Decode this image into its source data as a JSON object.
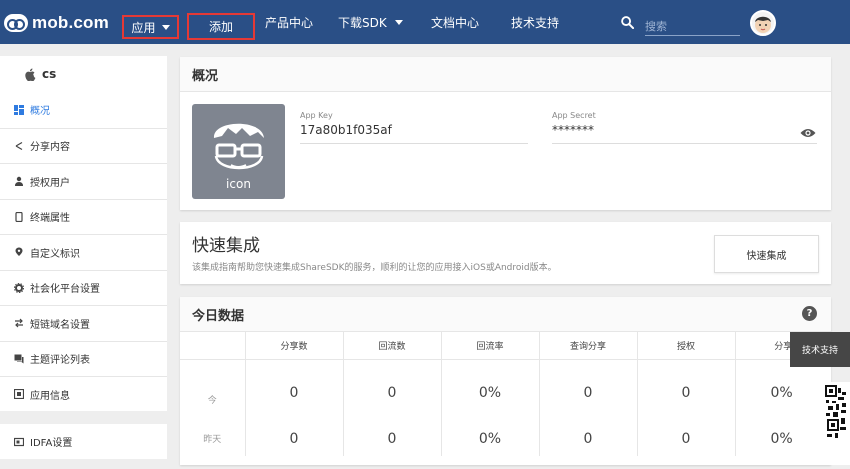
{
  "header": {
    "logo": "mob.com",
    "nav": [
      {
        "label": "应用",
        "has_caret": true
      },
      {
        "label": "添加",
        "has_caret": false
      },
      {
        "label": "产品中心",
        "has_caret": false
      },
      {
        "label": "下载SDK",
        "has_caret": true
      },
      {
        "label": "文档中心",
        "has_caret": false
      },
      {
        "label": "技术支持",
        "has_caret": false
      }
    ],
    "search_placeholder": "搜索"
  },
  "sidebar": {
    "app_name": "cs",
    "items": [
      {
        "label": "概况",
        "icon": "dashboard-icon",
        "active": true
      },
      {
        "label": "分享内容",
        "icon": "share-icon",
        "active": false
      },
      {
        "label": "授权用户",
        "icon": "user-icon",
        "active": false
      },
      {
        "label": "终端属性",
        "icon": "phone-icon",
        "active": false
      },
      {
        "label": "自定义标识",
        "icon": "map-pin-icon",
        "active": false
      },
      {
        "label": "社会化平台设置",
        "icon": "gear-icon",
        "active": false
      },
      {
        "label": "短链域名设置",
        "icon": "link-icon",
        "active": false
      },
      {
        "label": "主题评论列表",
        "icon": "comment-icon",
        "active": false
      },
      {
        "label": "应用信息",
        "icon": "info-icon",
        "active": false
      }
    ],
    "extra_item": {
      "label": "IDFA设置",
      "icon": "idfa-icon"
    }
  },
  "overview": {
    "title": "概况",
    "icon_label": "icon",
    "app_key_label": "App Key",
    "app_key_value": "17a80b1f035af",
    "app_secret_label": "App Secret",
    "app_secret_value": "*******"
  },
  "quick_start": {
    "title": "快速集成",
    "description": "该集成指南帮助您快速集成ShareSDK的服务，顺利的让您的应用接入iOS或Android版本。",
    "button": "快速集成"
  },
  "today": {
    "title": "今日数据",
    "columns": [
      "分享数",
      "回流数",
      "回流率",
      "查询分享",
      "授权",
      "分享"
    ],
    "rows": [
      {
        "label": "今",
        "values": [
          "0",
          "0",
          "0%",
          "0",
          "0",
          "0%"
        ]
      },
      {
        "label": "昨天",
        "values": [
          "0",
          "0",
          "0%",
          "0",
          "0",
          "0%"
        ]
      }
    ]
  },
  "floating": {
    "support_label": "技术支持"
  },
  "colors": {
    "header_bg": "#2a4f86",
    "highlight_border": "#e53935",
    "active_link": "#2f7be0"
  }
}
